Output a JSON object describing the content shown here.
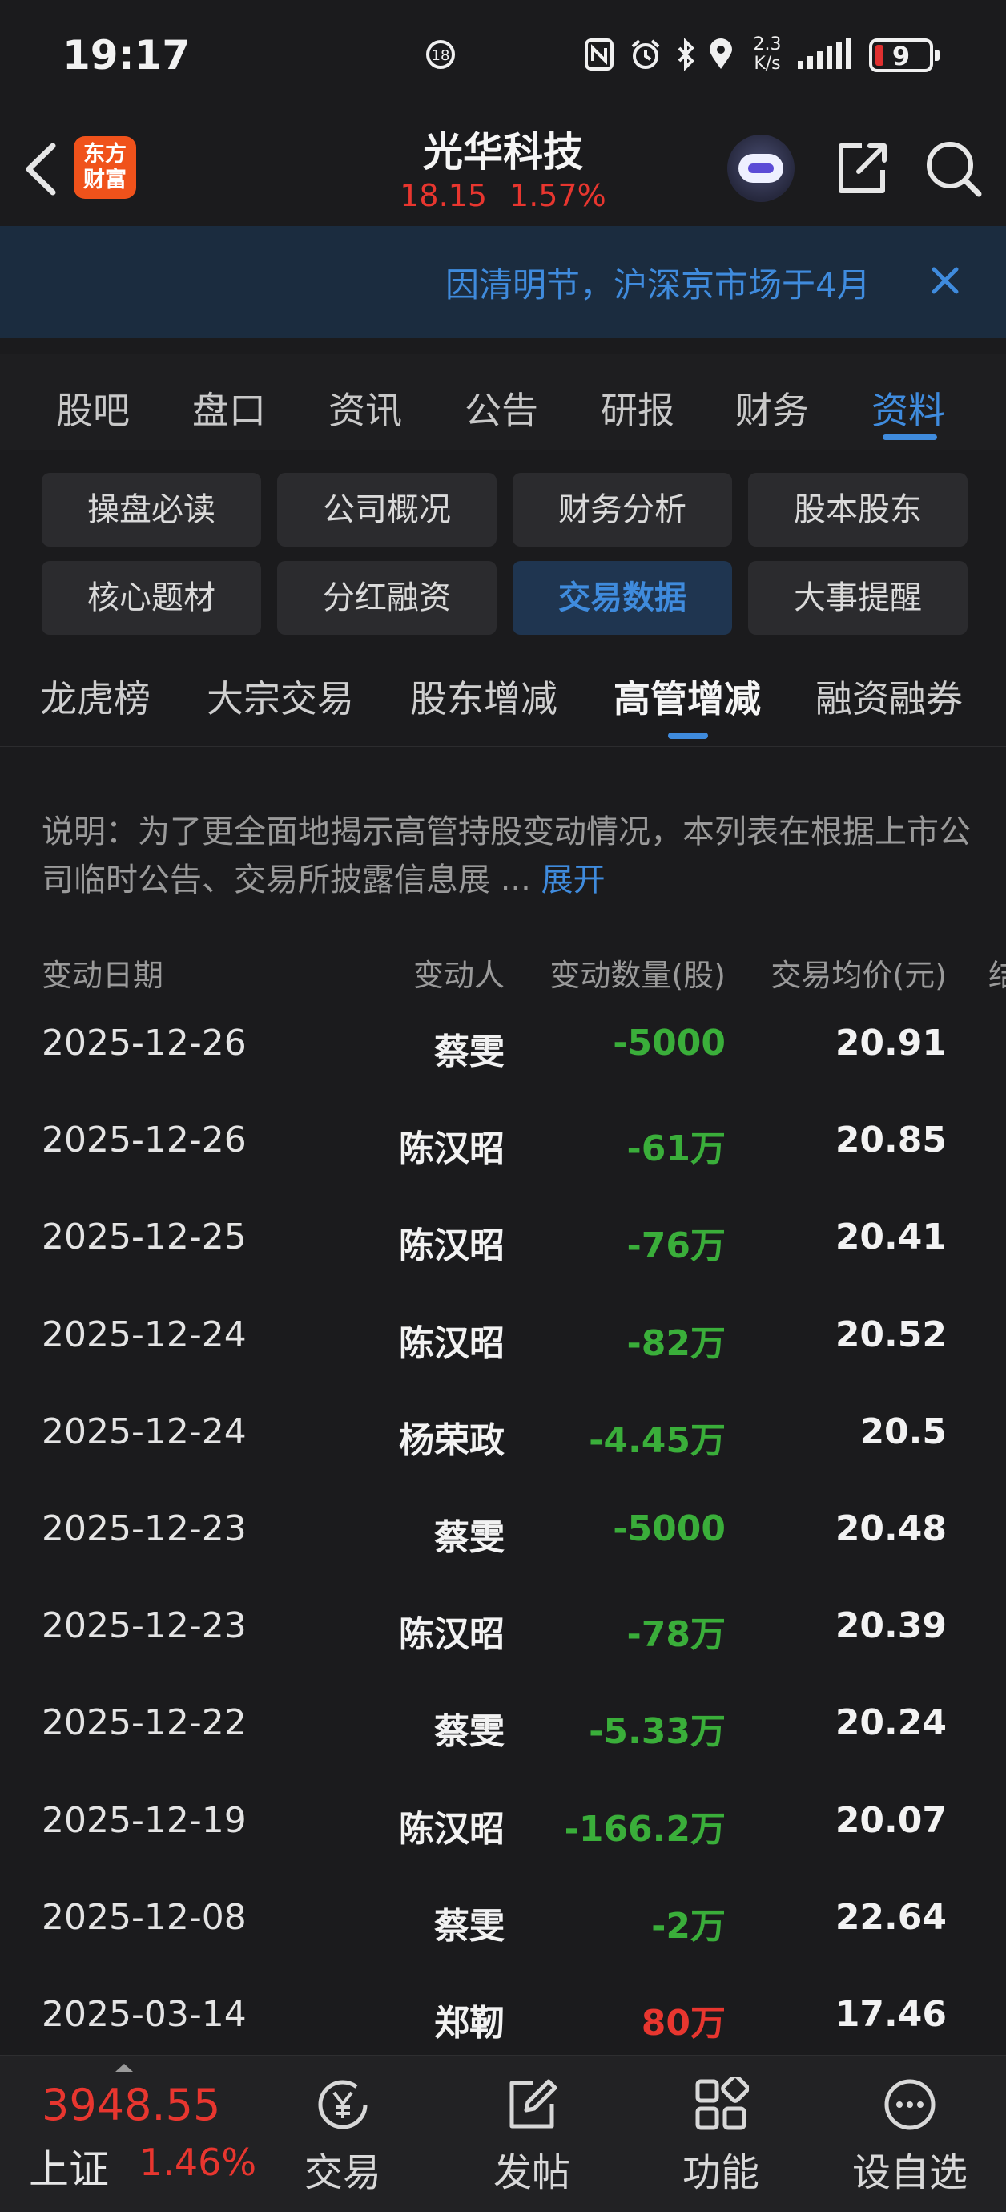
{
  "status_bar": {
    "time": "19:17",
    "net_speed_value": "2.3",
    "net_speed_unit": "K/s",
    "battery": "9"
  },
  "header": {
    "logo_line1": "东方",
    "logo_line2": "财富",
    "stock_name": "光华科技",
    "price": "18.15",
    "change_pct": "1.57%"
  },
  "notice": {
    "text": "因清明节，沪深京市场于4月"
  },
  "tabs": [
    "股吧",
    "盘口",
    "资讯",
    "公告",
    "研报",
    "财务",
    "资料"
  ],
  "active_tab": "资料",
  "sub_menu": [
    [
      "操盘必读",
      "公司概况",
      "财务分析",
      "股本股东"
    ],
    [
      "核心题材",
      "分红融资",
      "交易数据",
      "大事提醒"
    ]
  ],
  "active_sub_menu": "交易数据",
  "data_tabs": [
    "龙虎榜",
    "大宗交易",
    "股东增减",
    "高管增减",
    "融资融券"
  ],
  "active_data_tab": "高管增减",
  "description": {
    "text": "说明：为了更全面地揭示高管持股变动情况，本列表在根据上市公司临时公告、交易所披露信息展 ...",
    "expand": "展开"
  },
  "table": {
    "headers": [
      "变动日期",
      "变动人",
      "变动数量(股)",
      "交易均价(元)",
      "结"
    ],
    "rows": [
      {
        "date": "2025-12-26",
        "person": "蔡雯",
        "qty": "-5000",
        "price": "20.91",
        "dir": "neg"
      },
      {
        "date": "2025-12-26",
        "person": "陈汉昭",
        "qty": "-61万",
        "price": "20.85",
        "dir": "neg"
      },
      {
        "date": "2025-12-25",
        "person": "陈汉昭",
        "qty": "-76万",
        "price": "20.41",
        "dir": "neg"
      },
      {
        "date": "2025-12-24",
        "person": "陈汉昭",
        "qty": "-82万",
        "price": "20.52",
        "dir": "neg"
      },
      {
        "date": "2025-12-24",
        "person": "杨荣政",
        "qty": "-4.45万",
        "price": "20.5",
        "dir": "neg"
      },
      {
        "date": "2025-12-23",
        "person": "蔡雯",
        "qty": "-5000",
        "price": "20.48",
        "dir": "neg"
      },
      {
        "date": "2025-12-23",
        "person": "陈汉昭",
        "qty": "-78万",
        "price": "20.39",
        "dir": "neg"
      },
      {
        "date": "2025-12-22",
        "person": "蔡雯",
        "qty": "-5.33万",
        "price": "20.24",
        "dir": "neg"
      },
      {
        "date": "2025-12-19",
        "person": "陈汉昭",
        "qty": "-166.2万",
        "price": "20.07",
        "dir": "neg"
      },
      {
        "date": "2025-12-08",
        "person": "蔡雯",
        "qty": "-2万",
        "price": "22.64",
        "dir": "neg"
      },
      {
        "date": "2025-03-14",
        "person": "郑靭",
        "qty": "80万",
        "price": "17.46",
        "dir": "pos"
      }
    ]
  },
  "bottom_bar": {
    "index_value": "3948.55",
    "index_name": "上证",
    "index_pct": "1.46%",
    "nav": [
      "交易",
      "发帖",
      "功能",
      "设自选"
    ]
  },
  "colors": {
    "accent": "#3f8bdd",
    "up": "#e8362f",
    "down": "#3aae3a",
    "background": "#1b1b1d"
  }
}
